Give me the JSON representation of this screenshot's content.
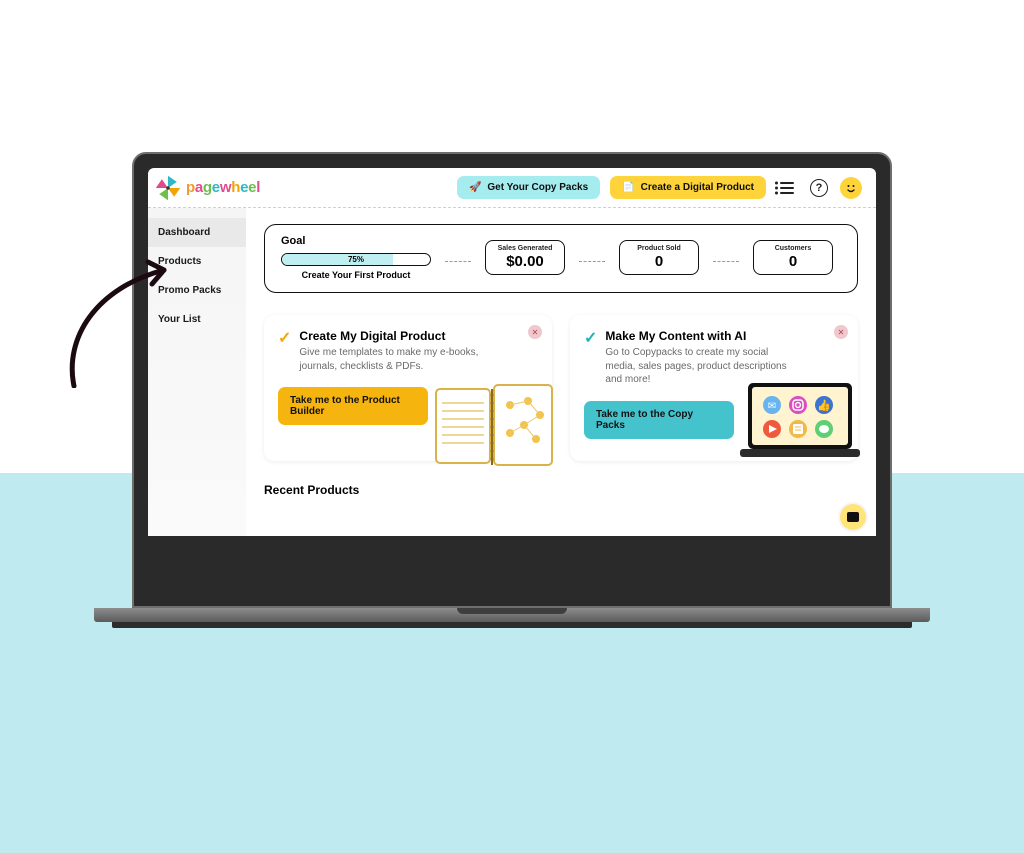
{
  "brand": "pagewheel",
  "header": {
    "copy_packs_label": "Get Your Copy Packs",
    "create_product_label": "Create a Digital Product"
  },
  "sidebar": {
    "items": [
      {
        "label": "Dashboard",
        "active": true
      },
      {
        "label": "Products",
        "active": false
      },
      {
        "label": "Promo Packs",
        "active": false
      },
      {
        "label": "Your List",
        "active": false
      }
    ]
  },
  "goal": {
    "title": "Goal",
    "progress_percent": "75%",
    "progress_subtitle": "Create Your First Product",
    "stats": [
      {
        "label": "Sales Generated",
        "value": "$0.00"
      },
      {
        "label": "Product Sold",
        "value": "0"
      },
      {
        "label": "Customers",
        "value": "0"
      }
    ]
  },
  "cards": [
    {
      "title": "Create My Digital Product",
      "desc": "Give me templates to make my e-books, journals, checklists & PDFs.",
      "cta": "Take me to the Product Builder",
      "check_color": "yellow"
    },
    {
      "title": "Make My Content with AI",
      "desc": "Go to Copypacks to create my social media, sales pages, product descriptions and more!",
      "cta": "Take me to the Copy Packs",
      "check_color": "cyan"
    }
  ],
  "recent_title": "Recent Products",
  "colors": {
    "cyan": "#a5ecef",
    "yellow": "#ffd43b",
    "cta_yellow": "#f6b40e",
    "cta_cyan": "#45c3cc",
    "bg_bottom": "#bfeaef"
  }
}
